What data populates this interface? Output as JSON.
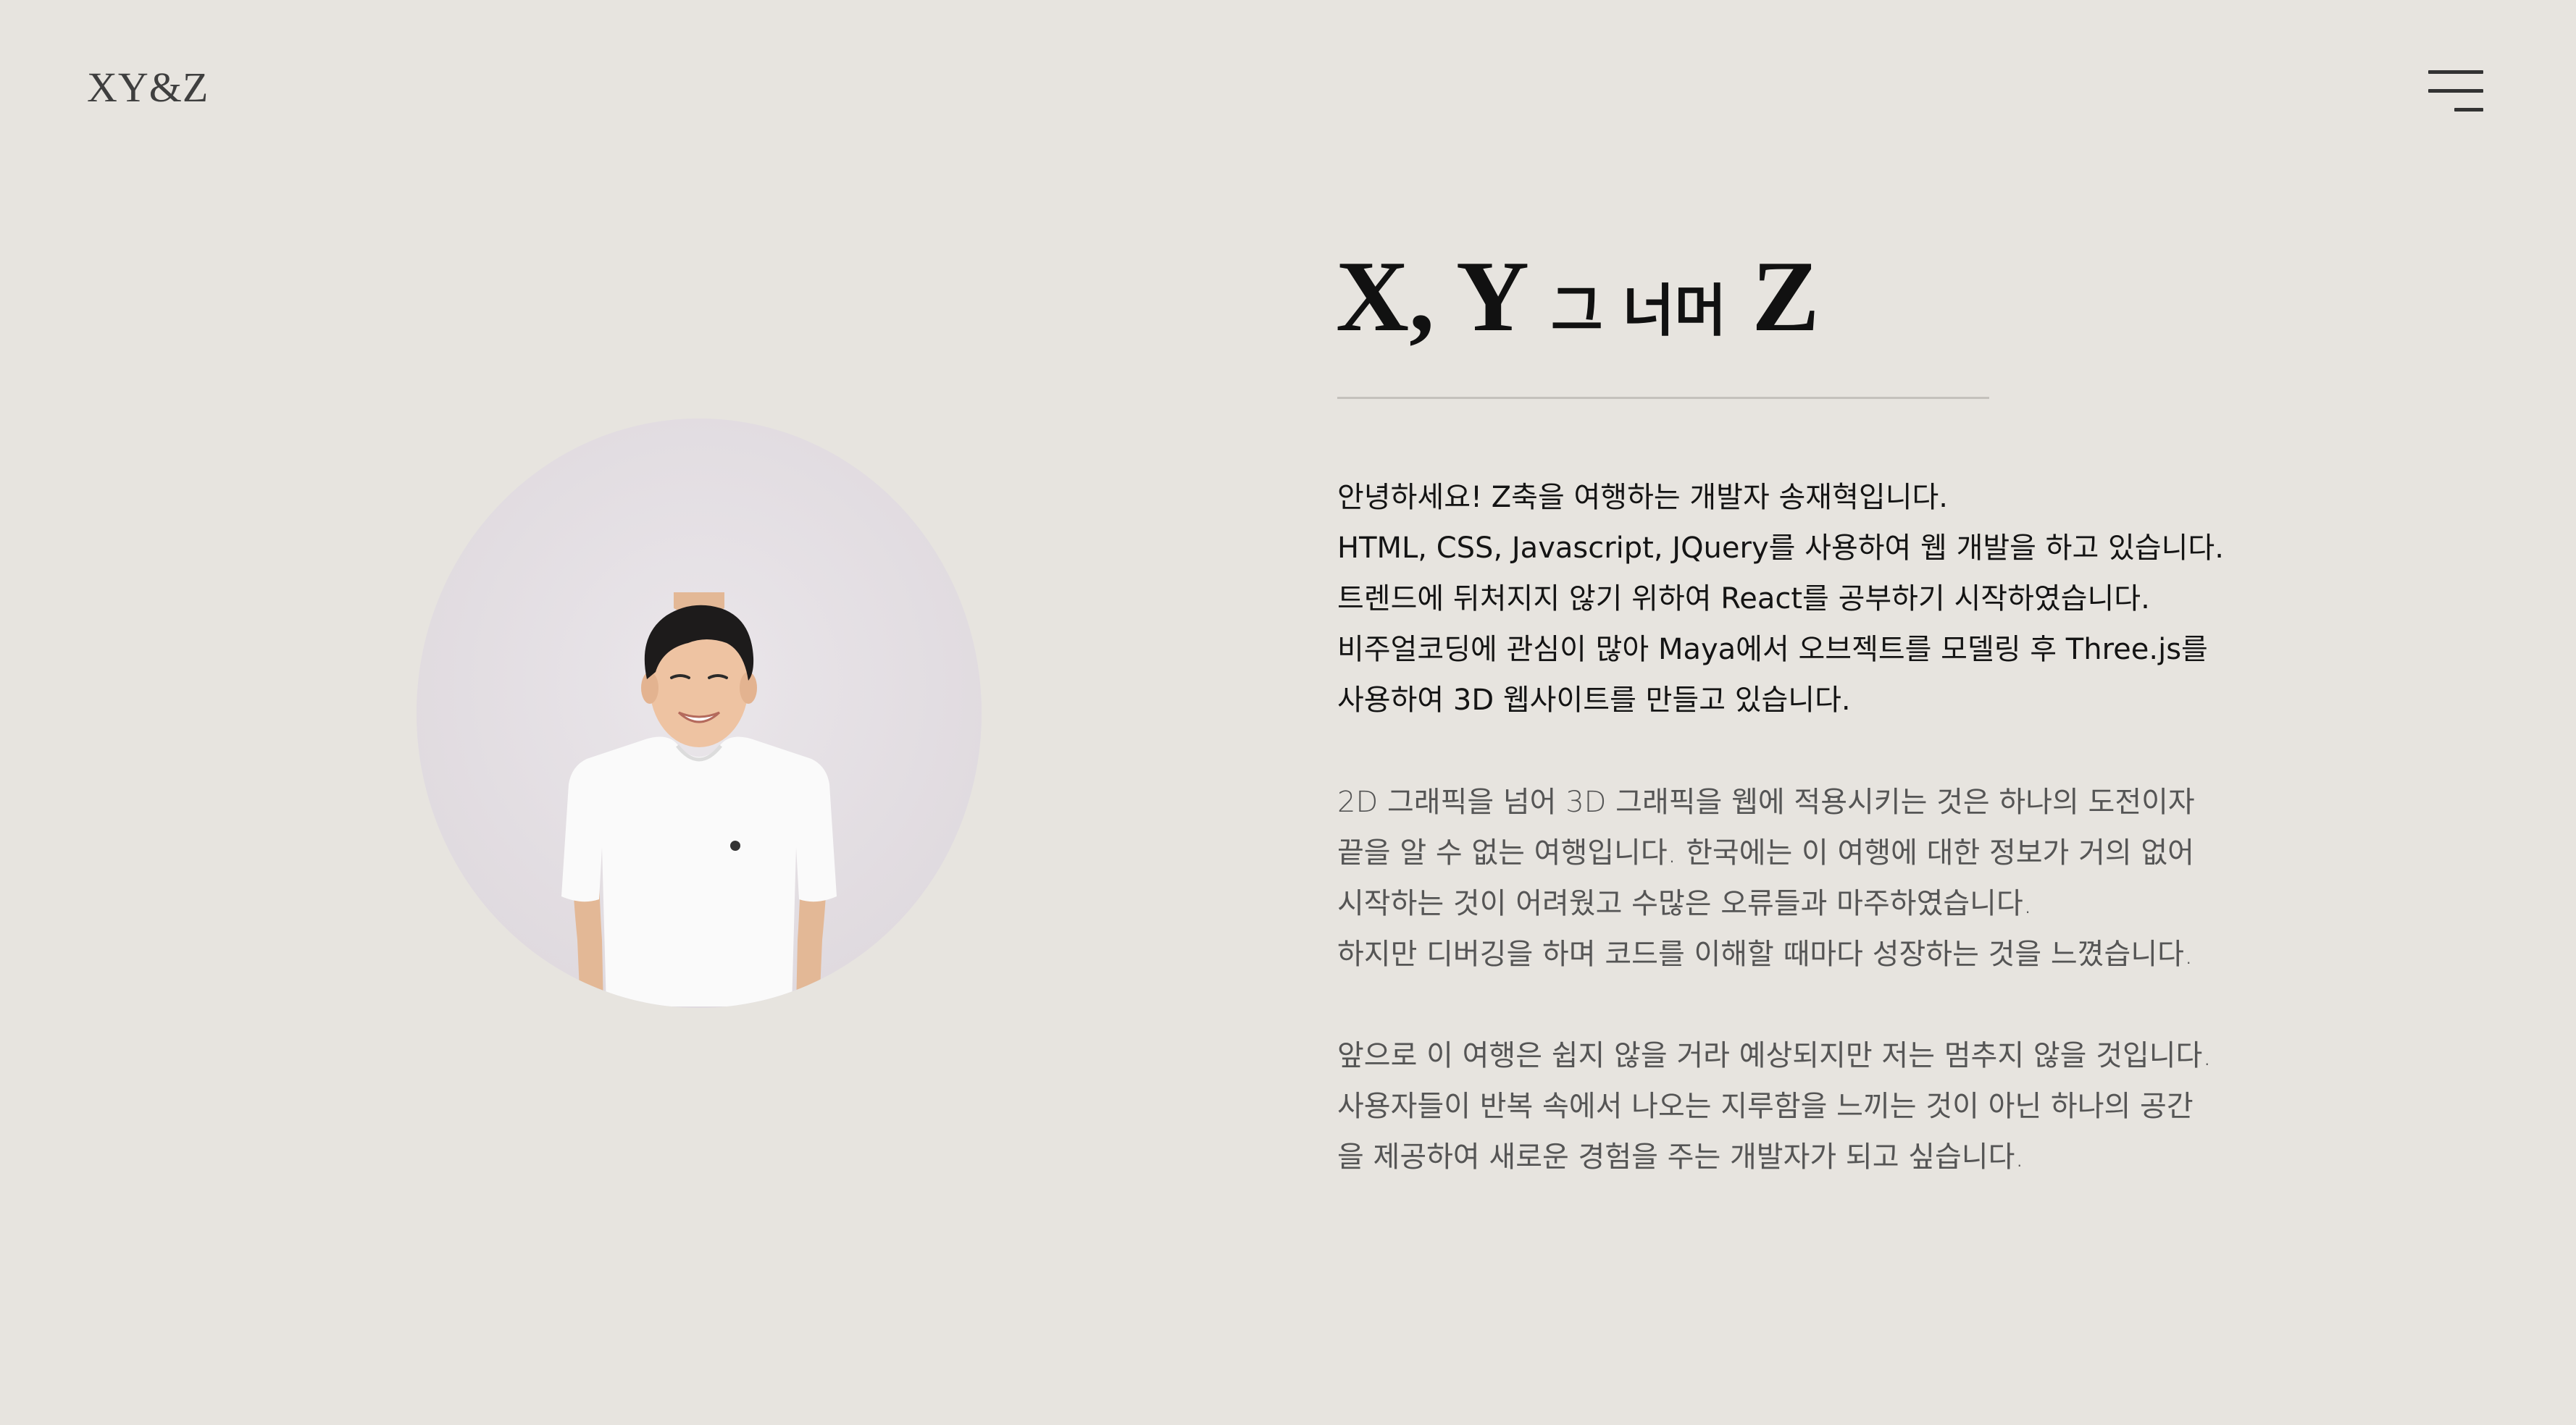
{
  "header": {
    "logo": "XY&Z",
    "menu_icon": "hamburger-menu-icon"
  },
  "hero": {
    "title_prefix": "X, Y",
    "title_middle": "그 너머",
    "title_suffix": "Z"
  },
  "profile": {
    "image": "portrait-photo"
  },
  "intro": [
    "안녕하세요! Z축을 여행하는 개발자 송재혁입니다.",
    "HTML, CSS, Javascript, JQuery를 사용하여 웹 개발을 하고 있습니다.",
    "트렌드에 뒤처지지 않기 위하여 React를 공부하기 시작하였습니다.",
    "비주얼코딩에 관심이 많아 Maya에서 오브젝트를 모델링 후 Three.js를",
    "사용하여 3D 웹사이트를 만들고 있습니다."
  ],
  "story": [
    "2D 그래픽을 넘어 3D 그래픽을 웹에 적용시키는 것은 하나의 도전이자",
    "끝을 알 수 없는 여행입니다. 한국에는 이 여행에 대한 정보가 거의 없어",
    "시작하는 것이 어려웠고 수많은 오류들과 마주하였습니다.",
    "하지만 디버깅을 하며 코드를 이해할 때마다 성장하는 것을 느꼈습니다."
  ],
  "future": [
    "앞으로 이 여행은 쉽지 않을 거라 예상되지만 저는 멈추지 않을 것입니다.",
    "사용자들이 반복 속에서 나오는 지루함을 느끼는 것이 아닌 하나의 공간",
    "을 제공하여 새로운 경험을 주는 개발자가 되고 싶습니다."
  ]
}
